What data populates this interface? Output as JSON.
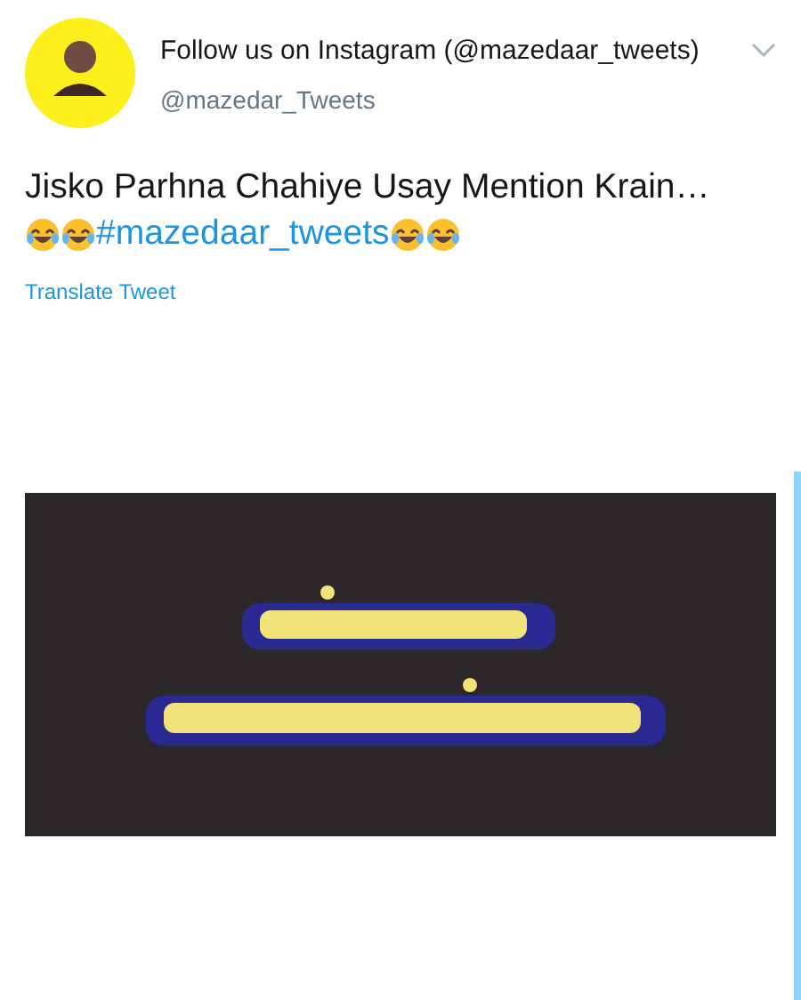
{
  "tweet": {
    "author_name": "Follow us on Instagram (@mazedaar_tweets)",
    "handle": "@mazedar_Tweets",
    "text": "Jisko Parhna Chahiye Usay Mention Krain…",
    "hashtag": "#mazedaar_tweets",
    "translate_link": "Translate Tweet"
  }
}
